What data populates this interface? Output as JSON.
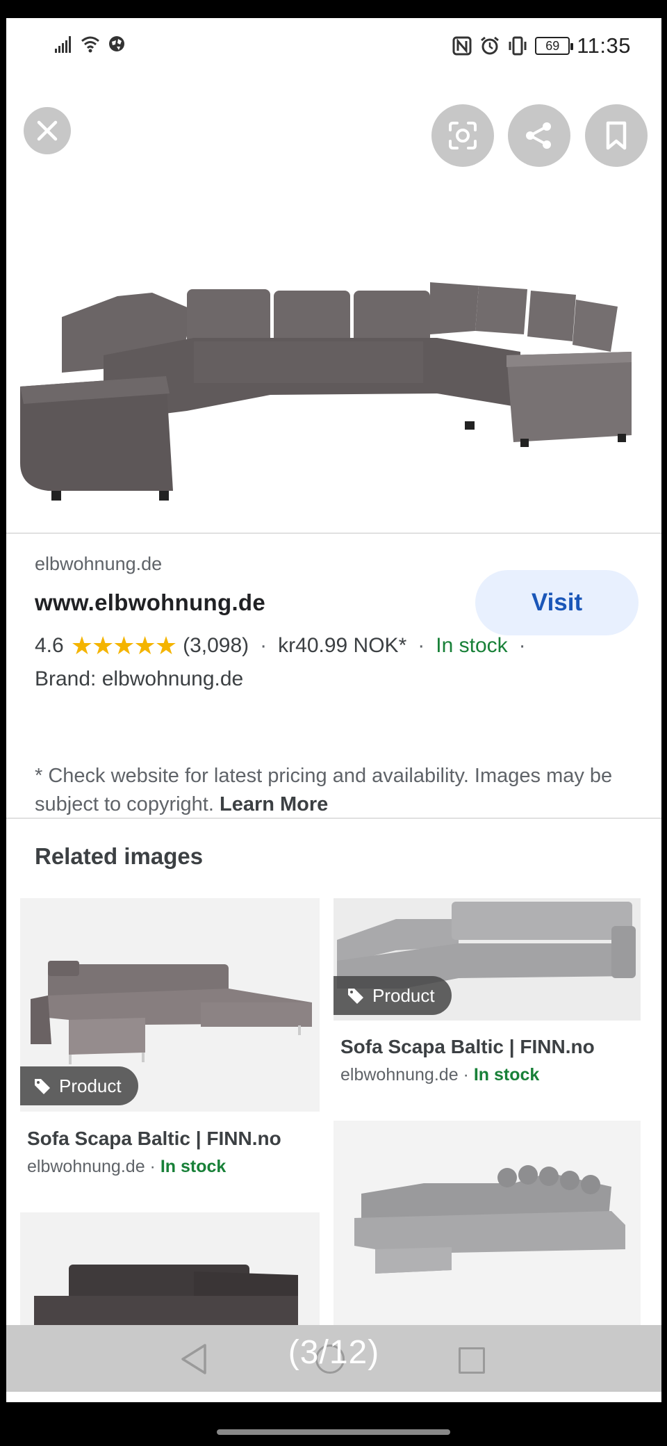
{
  "status_bar": {
    "time": "11:35",
    "battery": "69",
    "icons": [
      "signal-icon",
      "wifi-icon",
      "globe-icon",
      "nfc-icon",
      "alarm-icon",
      "vibrate-icon",
      "battery-icon"
    ]
  },
  "hero": {
    "close_icon": "close-icon",
    "actions": [
      "lens-icon",
      "share-icon",
      "bookmark-icon"
    ]
  },
  "result": {
    "domain": "elbwohnung.de",
    "site_title": "www.elbwohnung.de",
    "visit_label": "Visit",
    "rating": "4.6",
    "stars": "★★★★★",
    "reviews": "(3,098)",
    "price": "kr40.99 NOK*",
    "availability": "In stock",
    "brand": "Brand: elbwohnung.de",
    "disclaimer": "* Check website for latest pricing and availability. Images may be subject to copyright.",
    "learn_more": "Learn More"
  },
  "related": {
    "title": "Related images",
    "items": [
      {
        "chip": "Product",
        "title": "Sofa Scapa Baltic | FINN.no",
        "source": "elbwohnung.de",
        "availability": "In stock"
      },
      {
        "chip": "Product",
        "title": "Sofa Scapa Baltic | FINN.no",
        "source": "elbwohnung.de",
        "availability": "In stock"
      }
    ]
  },
  "viewer": {
    "counter": "(3/12)"
  },
  "colors": {
    "accent_blue": "#1a56b8",
    "stock_green": "#188038",
    "star_yellow": "#f4b400"
  }
}
